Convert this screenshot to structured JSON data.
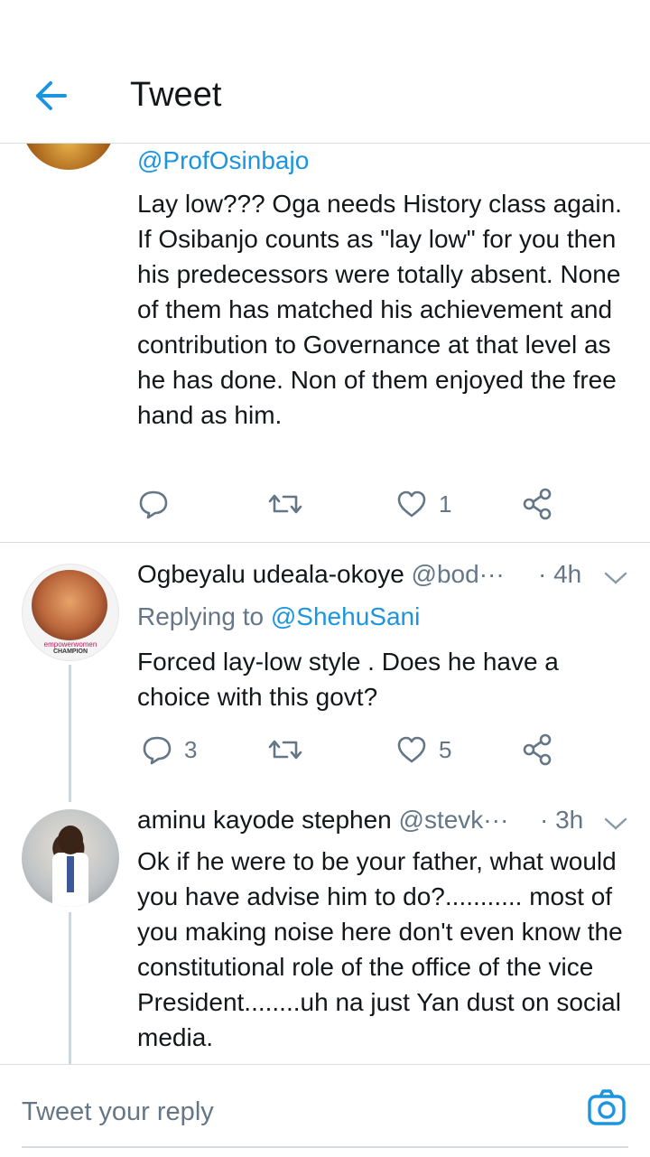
{
  "header": {
    "title": "Tweet"
  },
  "tweet1": {
    "handle": "@ProfOsinbajo",
    "text": "Lay low??? Oga needs History class again. If Osibanjo counts as \"lay low\" for you then his predecessors were totally absent. None of them has matched his achievement and contribution to Governance at that level as he has done. Non of them enjoyed the free hand as him.",
    "likes": "1"
  },
  "tweet2": {
    "name": "Ogbeyalu udeala-okoye",
    "handle": "@bod···",
    "time": "· 4h",
    "replying_prefix": "Replying to",
    "replying_to": "@ShehuSani",
    "text": "Forced lay-low style . Does he have a choice with this govt?",
    "replies": "3",
    "likes": "5",
    "avatar_badge_line1": "empowerwomen",
    "avatar_badge_line2": "CHAMPION"
  },
  "tweet3": {
    "name": "aminu kayode stephen",
    "handle": "@stevk···",
    "time": "· 3h",
    "text": "Ok if he were to be your father, what would you have advise him to do?........... most of you making noise here don't even know the constitutional role of the office of the vice President........uh na just Yan dust on social media."
  },
  "composer": {
    "placeholder": "Tweet your reply"
  },
  "colors": {
    "accent": "#1b95e0",
    "muted": "#657786",
    "text": "#14171a"
  },
  "icons": [
    "back-arrow-icon",
    "reply-icon",
    "retweet-icon",
    "like-icon",
    "share-icon",
    "chevron-down-icon",
    "camera-icon"
  ]
}
